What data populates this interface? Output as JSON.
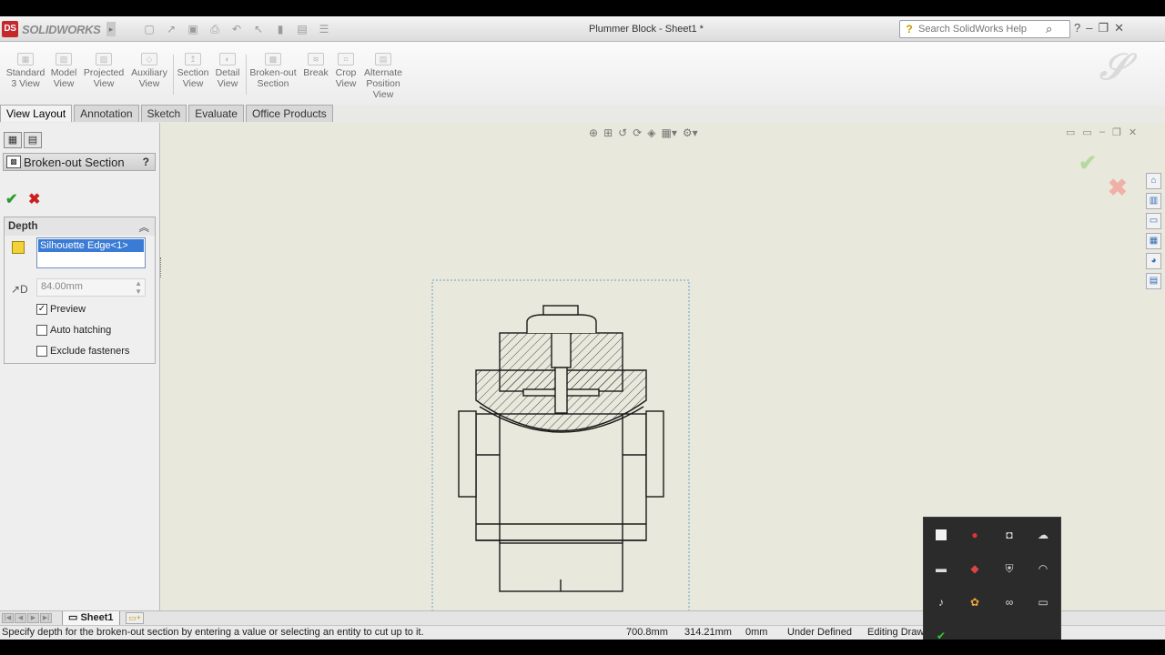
{
  "app": {
    "logo": "SOLIDWORKS",
    "document_title": "Plummer Block - Sheet1 *",
    "search_placeholder": "Search SolidWorks Help"
  },
  "commands": [
    {
      "line1": "Standard",
      "line2": "3 View",
      "line3": ""
    },
    {
      "line1": "Model",
      "line2": "View",
      "line3": ""
    },
    {
      "line1": "Projected",
      "line2": "View",
      "line3": ""
    },
    {
      "line1": "Auxiliary",
      "line2": "View",
      "line3": ""
    },
    {
      "line1": "Section",
      "line2": "View",
      "line3": ""
    },
    {
      "line1": "Detail",
      "line2": "View",
      "line3": ""
    },
    {
      "line1": "Broken-out",
      "line2": "Section",
      "line3": ""
    },
    {
      "line1": "Break",
      "line2": "",
      "line3": ""
    },
    {
      "line1": "Crop",
      "line2": "View",
      "line3": ""
    },
    {
      "line1": "Alternate",
      "line2": "Position",
      "line3": "View"
    }
  ],
  "tabs": [
    "View Layout",
    "Annotation",
    "Sketch",
    "Evaluate",
    "Office Products"
  ],
  "property_manager": {
    "title": "Broken-out Section",
    "help": "?",
    "depth_group": "Depth",
    "selected_entity": "Silhouette Edge<1>",
    "depth_value": "84.00mm",
    "checkboxes": [
      {
        "label": "Preview",
        "checked": true
      },
      {
        "label": "Auto hatching",
        "checked": false
      },
      {
        "label": "Exclude fasteners",
        "checked": false
      }
    ]
  },
  "sheet": {
    "tab": "Sheet1"
  },
  "status": {
    "message": "Specify depth for the broken-out section by entering a value or selecting an entity to cut up to it.",
    "x": "700.8mm",
    "y": "314.21mm",
    "z": "0mm",
    "definition": "Under Defined",
    "mode": "Editing Draw"
  },
  "colors": {
    "accent_selection": "#3a7bd5",
    "ok_green": "#2e9a2e",
    "cancel_red": "#cc1f1f",
    "canvas_bg": "#e8e8dc"
  }
}
